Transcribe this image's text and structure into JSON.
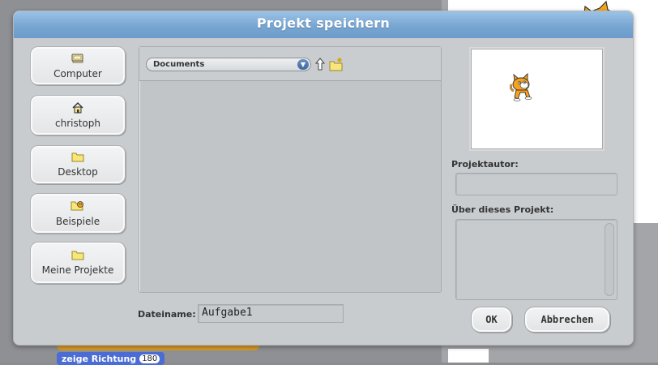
{
  "dialog": {
    "title": "Projekt speichern"
  },
  "sidebar": {
    "items": [
      {
        "label": "Computer",
        "icon": "computer-icon"
      },
      {
        "label": "christoph",
        "icon": "home-icon"
      },
      {
        "label": "Desktop",
        "icon": "folder-icon"
      },
      {
        "label": "Beispiele",
        "icon": "examples-icon"
      },
      {
        "label": "Meine Projekte",
        "icon": "folder-icon"
      }
    ]
  },
  "browser": {
    "location": "Documents",
    "up_icon": "up-arrow-icon",
    "new_folder_icon": "new-folder-icon"
  },
  "filename": {
    "label": "Dateiname:",
    "value": "Aufgabe1"
  },
  "details": {
    "author_label": "Projektautor:",
    "author_value": "",
    "about_label": "Über dieses Projekt:",
    "about_value": ""
  },
  "buttons": {
    "ok": "OK",
    "cancel": "Abbrechen"
  },
  "background": {
    "block_label": "zeige Richtung",
    "block_value": "180"
  },
  "colors": {
    "titlebar": "#78a6d2",
    "dialog": "#c9cccf",
    "block": "#4a6cd4"
  }
}
